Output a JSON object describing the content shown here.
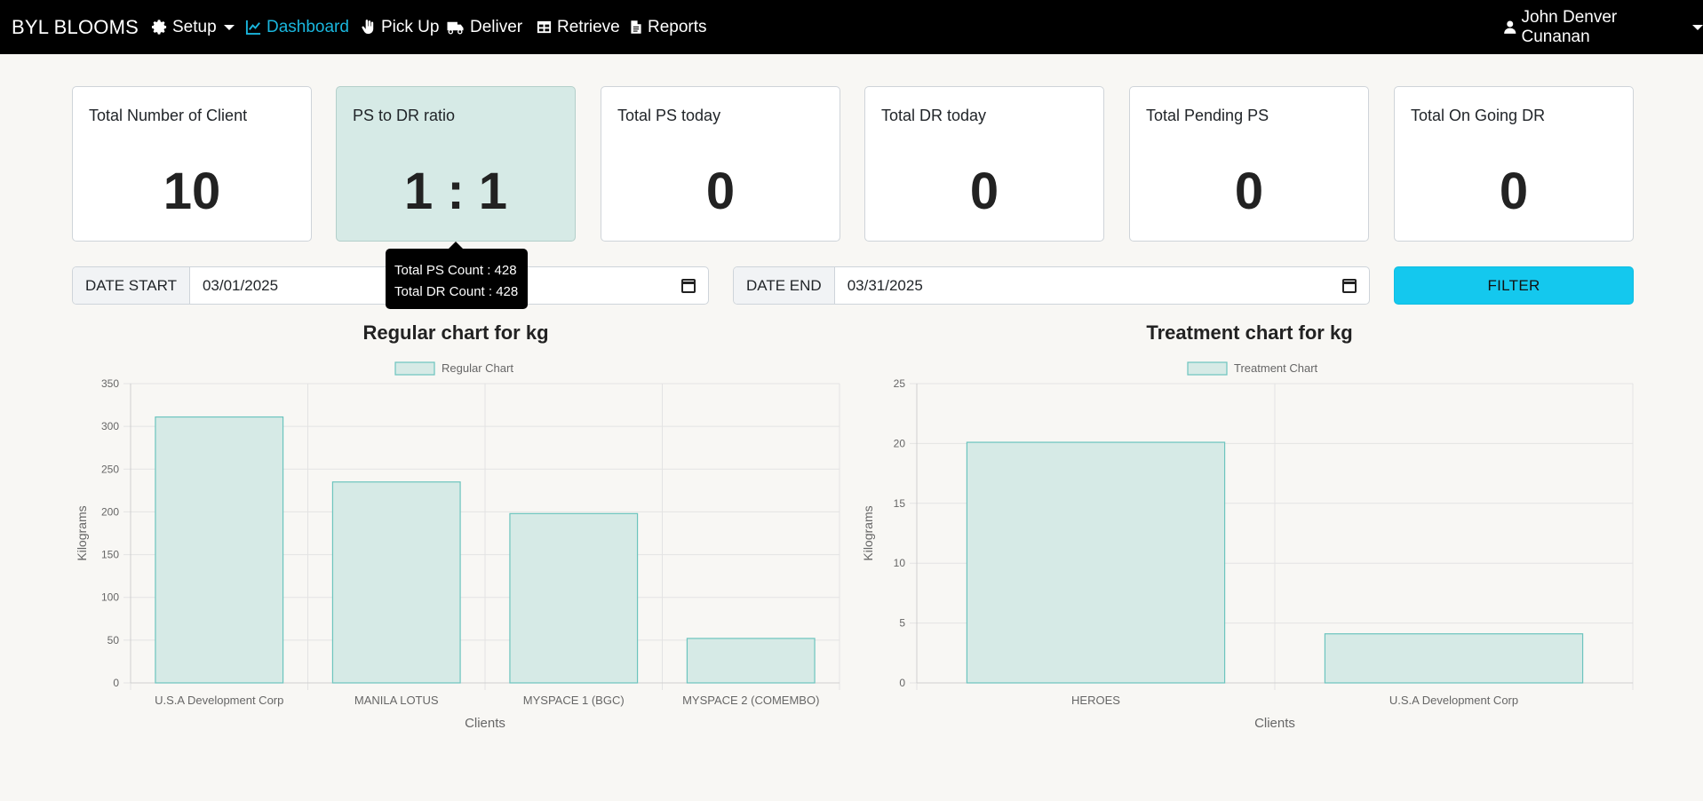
{
  "nav": {
    "brand": "BYL BLOOMS",
    "items": [
      {
        "label": "Setup",
        "icon": "gear-icon",
        "dropdown": true
      },
      {
        "label": "Dashboard",
        "icon": "chart-line-icon",
        "active": true
      },
      {
        "label": "Pick Up",
        "icon": "hand-icon"
      },
      {
        "label": "Deliver",
        "icon": "truck-icon"
      },
      {
        "label": "Retrieve",
        "icon": "table-icon"
      },
      {
        "label": "Reports",
        "icon": "file-icon"
      }
    ],
    "user": "John Denver Cunanan"
  },
  "cards": [
    {
      "title": "Total Number of Client",
      "value": "10"
    },
    {
      "title": "PS to DR ratio",
      "value": "1 : 1",
      "highlighted": true
    },
    {
      "title": "Total PS today",
      "value": "0"
    },
    {
      "title": "Total DR today",
      "value": "0"
    },
    {
      "title": "Total Pending PS",
      "value": "0"
    },
    {
      "title": "Total On Going DR",
      "value": "0"
    }
  ],
  "tooltip": {
    "line1": "Total PS Count : 428",
    "line2": "Total DR Count : 428"
  },
  "filters": {
    "start_label": "DATE START",
    "start_value": "03/01/2025",
    "end_label": "DATE END",
    "end_value": "03/31/2025",
    "button": "FILTER"
  },
  "colors": {
    "accent": "#1ab6dd",
    "bar_fill": "#d6eae6",
    "bar_border": "#6cc4be",
    "filter_button": "#14c8ee"
  },
  "chart_data": [
    {
      "type": "bar",
      "title": "Regular chart for kg",
      "legend": "Regular Chart",
      "xlabel": "Clients",
      "ylabel": "Kilograms",
      "categories": [
        "U.S.A Development Corp",
        "MANILA LOTUS",
        "MYSPACE 1 (BGC)",
        "MYSPACE 2 (COMEMBO)"
      ],
      "values": [
        311,
        235,
        198,
        52
      ],
      "ylim": [
        0,
        350
      ],
      "yticks": [
        0,
        50,
        100,
        150,
        200,
        250,
        300,
        350
      ],
      "grid": true,
      "legend_position": "top"
    },
    {
      "type": "bar",
      "title": "Treatment chart for kg",
      "legend": "Treatment Chart",
      "xlabel": "Clients",
      "ylabel": "Kilograms",
      "categories": [
        "HEROES",
        "U.S.A Development Corp"
      ],
      "values": [
        20.1,
        4.1
      ],
      "ylim": [
        0,
        25
      ],
      "yticks": [
        0,
        5,
        10,
        15,
        20,
        25
      ],
      "grid": true,
      "legend_position": "top"
    }
  ]
}
